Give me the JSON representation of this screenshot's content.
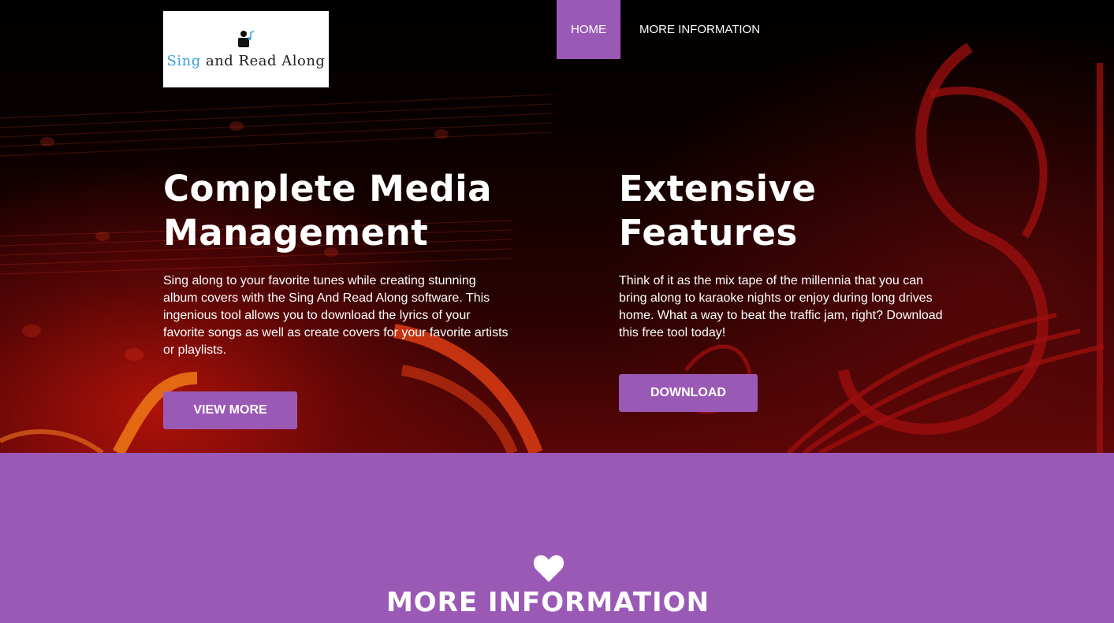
{
  "brand": {
    "logo_text_accent": "Sing",
    "logo_text_rest": " and Read Along",
    "logo_icon": "person-reading-icon"
  },
  "nav": {
    "items": [
      {
        "label": "HOME",
        "active": true
      },
      {
        "label": "MORE INFORMATION",
        "active": false
      }
    ]
  },
  "hero": {
    "left": {
      "title_line1": "Complete Media",
      "title_line2": "Management",
      "body": "Sing along to your favorite tunes while creating stunning album covers with the Sing And Read Along software. This ingenious tool allows you to download the lyrics of your favorite songs as well as create covers for your favorite artists or playlists.",
      "button_label": "VIEW MORE"
    },
    "right": {
      "title_line1": "Extensive",
      "title_line2": "Features",
      "body": "Think of it as the mix tape of the millennia that you can bring along to karaoke nights or enjoy during long drives home. What a way to beat the traffic jam, right? Download this free tool today!",
      "button_label": "DOWNLOAD"
    }
  },
  "info_section": {
    "icon": "heart-icon",
    "title": "MORE INFORMATION"
  },
  "colors": {
    "accent": "#9b59b6",
    "text": "#ffffff",
    "hero_dark": "#000000",
    "hero_red": "#b01408"
  }
}
